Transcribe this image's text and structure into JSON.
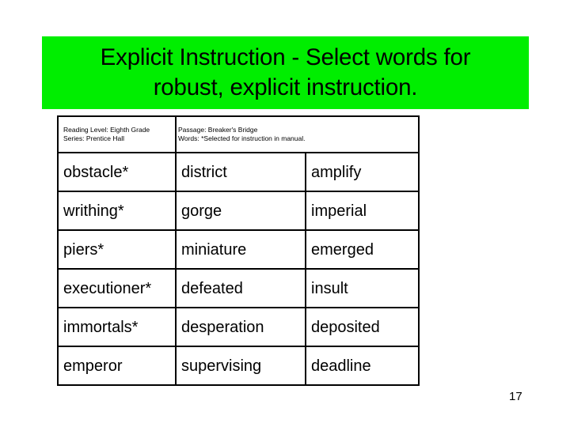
{
  "slide": {
    "title": "Explicit Instruction - Select words for\nrobust, explicit instruction.",
    "title_banner_color": "#00ee00",
    "page_number": "17"
  },
  "table": {
    "meta": {
      "left": "Reading Level: Eighth Grade\nSeries:  Prentice Hall",
      "middle": "Passage:  Breaker's Bridge\nWords: *Selected for instruction in manual.",
      "right": ""
    },
    "rows": [
      {
        "col1": "obstacle*",
        "col2": "district",
        "col3": "amplify"
      },
      {
        "col1": "writhing*",
        "col2": "gorge",
        "col3": "imperial"
      },
      {
        "col1": "piers*",
        "col2": "miniature",
        "col3": "emerged"
      },
      {
        "col1": "executioner*",
        "col2": "defeated",
        "col3": "insult"
      },
      {
        "col1": "immortals*",
        "col2": "desperation",
        "col3": "deposited"
      },
      {
        "col1": "emperor",
        "col2": "supervising",
        "col3": "deadline"
      }
    ]
  }
}
